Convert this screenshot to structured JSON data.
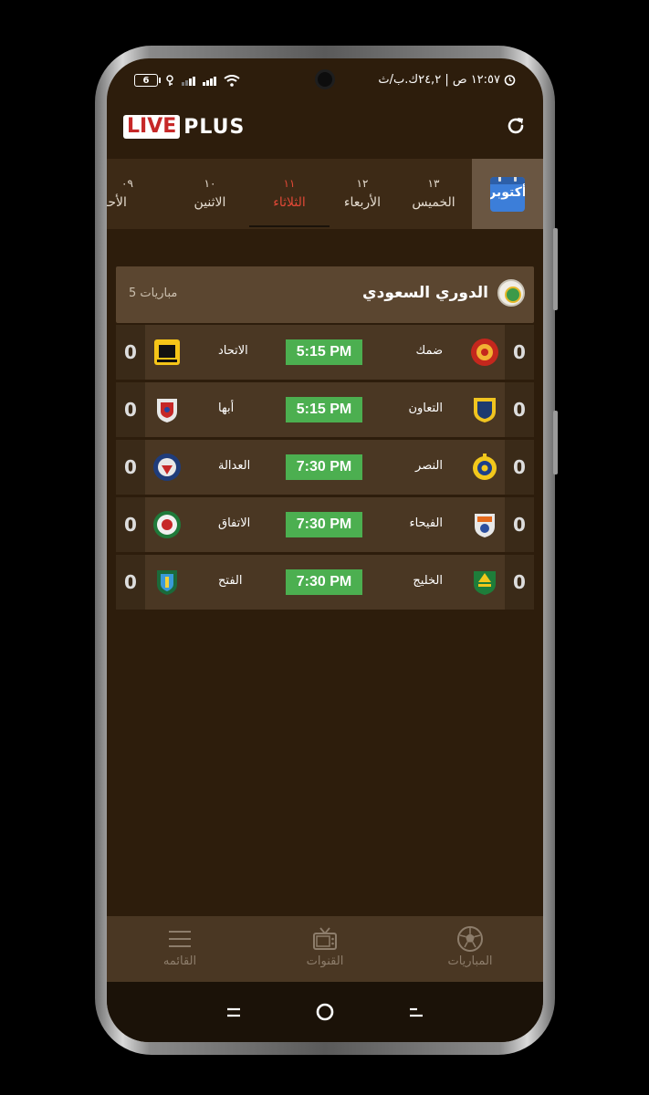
{
  "status": {
    "battery": "6",
    "time_text": "١٢:٥٧ ص | ٢٤,٢ك.ب/ث"
  },
  "header": {
    "logo_live": "LIVE",
    "logo_plus": "PLUS",
    "icons": [
      "refresh-icon"
    ]
  },
  "date_tabs": {
    "month": "أكتوبر",
    "days": [
      {
        "num": "١٣",
        "day": "الخميس"
      },
      {
        "num": "١٢",
        "day": "الأربعاء"
      },
      {
        "num": "١١",
        "day": "الثلاثاء"
      },
      {
        "num": "١٠",
        "day": "الاثنين"
      },
      {
        "num": "٠٩",
        "day": "الأحد"
      }
    ],
    "active_index": 2,
    "active_color": "#e04836"
  },
  "league": {
    "name": "الدوري السعودي",
    "count": "5 مباريات"
  },
  "matches": [
    {
      "home": "ضمك",
      "away": "الاتحاد",
      "time": "5:15 PM",
      "home_score": "0",
      "away_score": "0"
    },
    {
      "home": "التعاون",
      "away": "أبها",
      "time": "5:15 PM",
      "home_score": "0",
      "away_score": "0"
    },
    {
      "home": "النصر",
      "away": "العدالة",
      "time": "7:30 PM",
      "home_score": "0",
      "away_score": "0"
    },
    {
      "home": "الفيحاء",
      "away": "الاتفاق",
      "time": "7:30 PM",
      "home_score": "0",
      "away_score": "0"
    },
    {
      "home": "الخليج",
      "away": "الفتح",
      "time": "7:30 PM",
      "home_score": "0",
      "away_score": "0"
    }
  ],
  "bottom_nav": {
    "items": [
      {
        "label": "المباريات",
        "icon": "football-icon"
      },
      {
        "label": "القنوات",
        "icon": "tv-icon"
      },
      {
        "label": "القائمه",
        "icon": "menu-icon"
      }
    ]
  },
  "colors": {
    "background": "#2d1d0c",
    "card": "#4a3723",
    "time_badge": "#4caf50"
  }
}
